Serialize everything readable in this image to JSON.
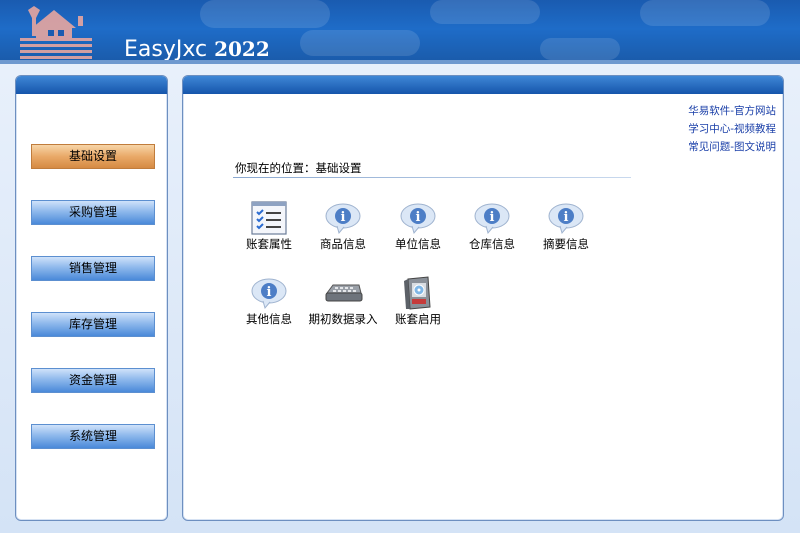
{
  "app": {
    "title": "EasyJxc",
    "year": "2022"
  },
  "sidebar": {
    "items": [
      {
        "label": "基础设置",
        "active": true
      },
      {
        "label": "采购管理",
        "active": false
      },
      {
        "label": "销售管理",
        "active": false
      },
      {
        "label": "库存管理",
        "active": false
      },
      {
        "label": "资金管理",
        "active": false
      },
      {
        "label": "系统管理",
        "active": false
      }
    ]
  },
  "links": [
    "华易软件-官方网站",
    "学习中心-视频教程",
    "常见问题-图文说明"
  ],
  "location": "你现在的位置：基础设置",
  "tiles": [
    {
      "label": "账套属性",
      "icon": "checklist-icon"
    },
    {
      "label": "商品信息",
      "icon": "info-bubble-icon"
    },
    {
      "label": "单位信息",
      "icon": "info-bubble-icon"
    },
    {
      "label": "仓库信息",
      "icon": "info-bubble-icon"
    },
    {
      "label": "摘要信息",
      "icon": "info-bubble-icon"
    },
    {
      "label": "其他信息",
      "icon": "info-bubble-icon"
    },
    {
      "label": "期初数据录入",
      "icon": "keyboard-icon"
    },
    {
      "label": "账套启用",
      "icon": "software-box-icon"
    }
  ],
  "colors": {
    "accent": "#1a5bb0",
    "active": "#e9a968",
    "link": "#1a3fa8"
  }
}
